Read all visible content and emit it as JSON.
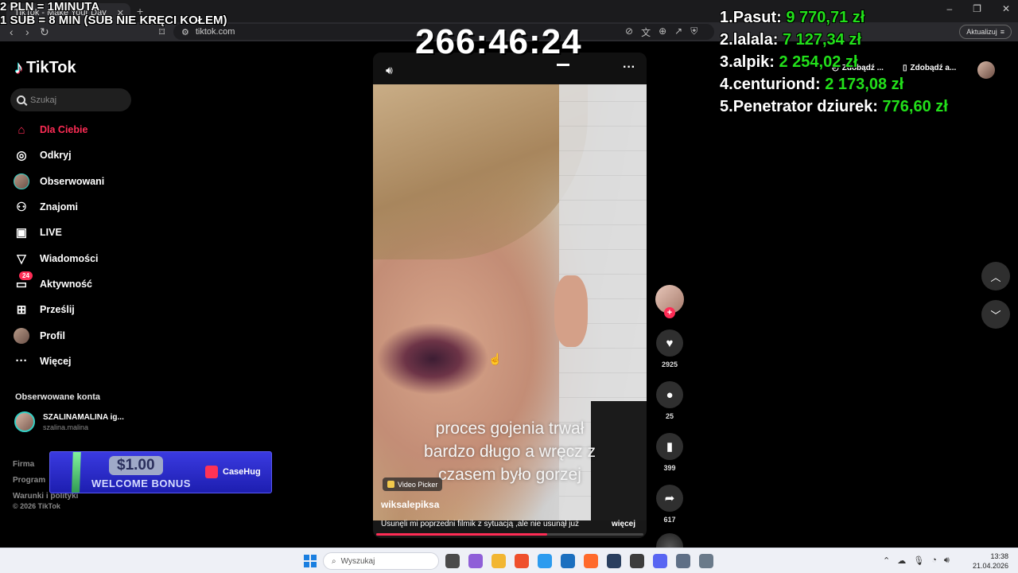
{
  "browser": {
    "tab_title": "TikTok - Make Your Day",
    "url": "tiktok.com",
    "update_label": "Aktualizuj"
  },
  "overlay": {
    "rule_line1": "2 PLN = 1MINUTA",
    "rule_line2": "1 SUB = 8 MIN (SUB NIE KRĘCI KOŁEM)",
    "timer": "266:46:24",
    "leaderboard": [
      {
        "rank": "1.",
        "name": "Pasut:",
        "amount": "9 770,71 zł"
      },
      {
        "rank": "2.",
        "name": "lalala:",
        "amount": "7 127,34 zł"
      },
      {
        "rank": "3.",
        "name": "alpik:",
        "amount": "2 254,02 zł"
      },
      {
        "rank": "4.",
        "name": "centuriond:",
        "amount": "2 173,08 zł"
      },
      {
        "rank": "5.",
        "name": "Penetrator dziurek:",
        "amount": "776,60 zł"
      }
    ]
  },
  "tiktok": {
    "logo": "TikTok",
    "search_placeholder": "Szukaj",
    "nav": [
      {
        "label": "Dla Ciebie",
        "icon": "home-icon",
        "active": true
      },
      {
        "label": "Odkryj",
        "icon": "compass-icon"
      },
      {
        "label": "Obserwowani",
        "icon": "following-avatar-icon"
      },
      {
        "label": "Znajomi",
        "icon": "friends-icon"
      },
      {
        "label": "LIVE",
        "icon": "live-tv-icon"
      },
      {
        "label": "Wiadomości",
        "icon": "messages-icon"
      },
      {
        "label": "Aktywność",
        "icon": "activity-icon",
        "badge": "24"
      },
      {
        "label": "Prześlij",
        "icon": "upload-icon"
      },
      {
        "label": "Profil",
        "icon": "profile-avatar-icon"
      },
      {
        "label": "Więcej",
        "icon": "more-dots-icon"
      }
    ],
    "followed_title": "Obserwowane konta",
    "followed": {
      "name": "SZALINAMALINA ig...",
      "handle": "szalina.malina"
    },
    "footer": [
      "Firma",
      "Program",
      "Warunki i polityki"
    ],
    "copyright": "© 2026 TikTok",
    "get_app_1": "Zdobądź ...",
    "get_app_2": "Zdobądź a..."
  },
  "promo": {
    "amount": "$1.00",
    "bonus": "WELCOME BONUS",
    "brand": "CaseHug"
  },
  "video": {
    "caption_lines": [
      "proces gojenia trwał",
      "bardzo długo a wręcz z",
      "czasem było gorzej"
    ],
    "picker_label": "Video Picker",
    "author": "wiksalepiksa",
    "description": "Usunęli mi poprzedni filmik z sytuacją ,ale nie usunął już",
    "more": "więcej",
    "progress": 0.64,
    "likes": "2925",
    "comments": "25",
    "saves": "399",
    "shares": "617"
  },
  "taskbar": {
    "search_placeholder": "Wyszukaj",
    "time": "13:38",
    "date": "21.04.2026",
    "app_colors": [
      "#4a4a4a",
      "#8f5fd8",
      "#f2b632",
      "#ef4f2c",
      "#2c9bef",
      "#1b6fbf",
      "#ff6a2c",
      "#2a3f5f",
      "#3c3c3c",
      "#5865f2",
      "#5f6f86",
      "#6a7a8a"
    ]
  }
}
